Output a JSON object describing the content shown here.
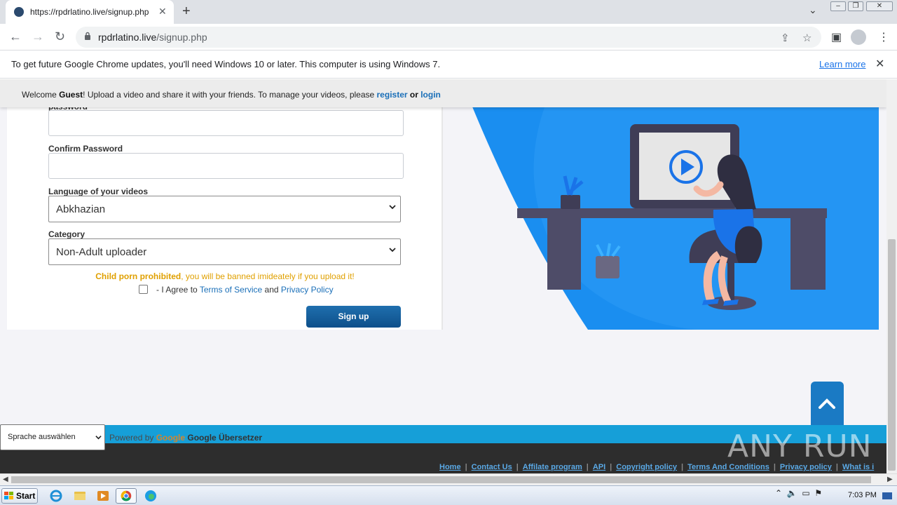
{
  "browser": {
    "tab_title": "https://rpdrlatino.live/signup.php",
    "url_host": "rpdrlatino.live",
    "url_path": "/signup.php"
  },
  "infobar": {
    "message": "To get future Google Chrome updates, you'll need Windows 10 or later. This computer is using Windows 7.",
    "learn_more": "Learn more"
  },
  "welcome": {
    "prefix": "Welcome ",
    "guest": "Guest",
    "middle": "! Upload a video and share it with your friends. To manage your videos, please ",
    "register": "register",
    "or": " or ",
    "login": "login"
  },
  "form": {
    "password_label": "password",
    "confirm_password_label": "Confirm Password",
    "language_label": "Language of your videos",
    "language_value": "Abkhazian",
    "category_label": "Category",
    "category_value": "Non-Adult uploader",
    "warning_bold": "Child porn prohibited",
    "warning_rest": ", you will be banned imideately if you upload it!",
    "agree_prefix": "- I Agree to ",
    "terms_link": "Terms of Service",
    "and": " and ",
    "privacy_link": "Privacy Policy",
    "signup_button": "Sign up"
  },
  "footer": {
    "language_select": "Sprache auswählen",
    "powered_by": "Powered by ",
    "google_logo": "Google",
    "translator": "Google Übersetzer",
    "links": [
      "Home",
      "Contact Us",
      "Affilate program",
      "API",
      "Copyright policy",
      "Terms And Conditions",
      "Privacy policy",
      "What is i"
    ]
  },
  "watermark": "ANY RUN",
  "taskbar": {
    "start": "Start",
    "clock": "7:03 PM"
  },
  "colors": {
    "accent_blue": "#1a7ac4",
    "illustration_blue": "#1a8ef0",
    "warning_orange": "#e0a000",
    "footer_blue": "#169fd8",
    "footer_dark": "#2d2d2d"
  },
  "icons": {
    "back": "arrow-left-icon",
    "forward": "arrow-right-icon",
    "reload": "reload-icon",
    "lock": "lock-icon",
    "share": "share-icon",
    "bookmark": "star-icon",
    "sidepanel": "side-panel-icon",
    "profile": "profile-icon",
    "menu": "kebab-menu-icon",
    "scroll_top": "chevron-up-icon"
  }
}
